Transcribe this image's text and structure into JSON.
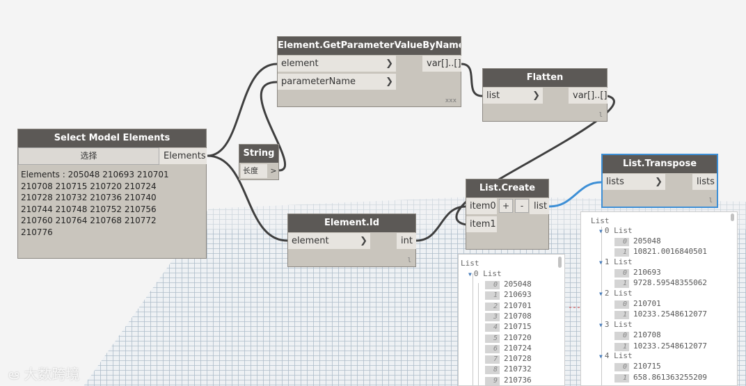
{
  "nodes": {
    "select_model": {
      "title": "Select Model Elements",
      "select_label": "选择",
      "output": "Elements",
      "preview_text": "Elements : 205048 210693 210701\n210708 210715 210720 210724\n210728 210732 210736 210740\n210744 210748 210752 210756\n210760 210764 210768 210772\n210776"
    },
    "get_param": {
      "title": "Element.GetParameterValueByName",
      "inputs": [
        "element",
        "parameterName"
      ],
      "output": "var[]..[]",
      "footer": "xxx"
    },
    "flatten": {
      "title": "Flatten",
      "input": "list",
      "output": "var[]..[]",
      "footer": "l"
    },
    "string": {
      "title": "String",
      "value": "长度",
      "output": ">"
    },
    "element_id": {
      "title": "Element.Id",
      "input": "element",
      "output": "int",
      "footer": "l"
    },
    "list_create": {
      "title": "List.Create",
      "inputs": [
        "item0",
        "item1"
      ],
      "add": "+",
      "remove": "-",
      "output": "list"
    },
    "list_transpose": {
      "title": "List.Transpose",
      "input": "lists",
      "output": "lists",
      "footer": "l"
    }
  },
  "wire_colors": {
    "default": "#3f3f3f",
    "selected": "#3d8fd6"
  },
  "preview_create": {
    "root": "List",
    "group": "0 List",
    "items": [
      {
        "i": "0",
        "v": "205048"
      },
      {
        "i": "1",
        "v": "210693"
      },
      {
        "i": "2",
        "v": "210701"
      },
      {
        "i": "3",
        "v": "210708"
      },
      {
        "i": "4",
        "v": "210715"
      },
      {
        "i": "5",
        "v": "210720"
      },
      {
        "i": "6",
        "v": "210724"
      },
      {
        "i": "7",
        "v": "210728"
      },
      {
        "i": "8",
        "v": "210732"
      },
      {
        "i": "9",
        "v": "210736"
      }
    ]
  },
  "preview_transpose": {
    "root": "List",
    "groups": [
      {
        "label": "0 List",
        "items": [
          {
            "i": "0",
            "v": "205048"
          },
          {
            "i": "1",
            "v": "10821.0016840501"
          }
        ]
      },
      {
        "label": "1 List",
        "items": [
          {
            "i": "0",
            "v": "210693"
          },
          {
            "i": "1",
            "v": "9728.59548355062"
          }
        ]
      },
      {
        "label": "2 List",
        "items": [
          {
            "i": "0",
            "v": "210701"
          },
          {
            "i": "1",
            "v": "10233.2548612077"
          }
        ]
      },
      {
        "label": "3 List",
        "items": [
          {
            "i": "0",
            "v": "210708"
          },
          {
            "i": "1",
            "v": "10233.2548612077"
          }
        ]
      },
      {
        "label": "4 List",
        "items": [
          {
            "i": "0",
            "v": "210715"
          },
          {
            "i": "1",
            "v": "658.861363255209"
          }
        ]
      }
    ]
  },
  "watermark": "大数跨境"
}
